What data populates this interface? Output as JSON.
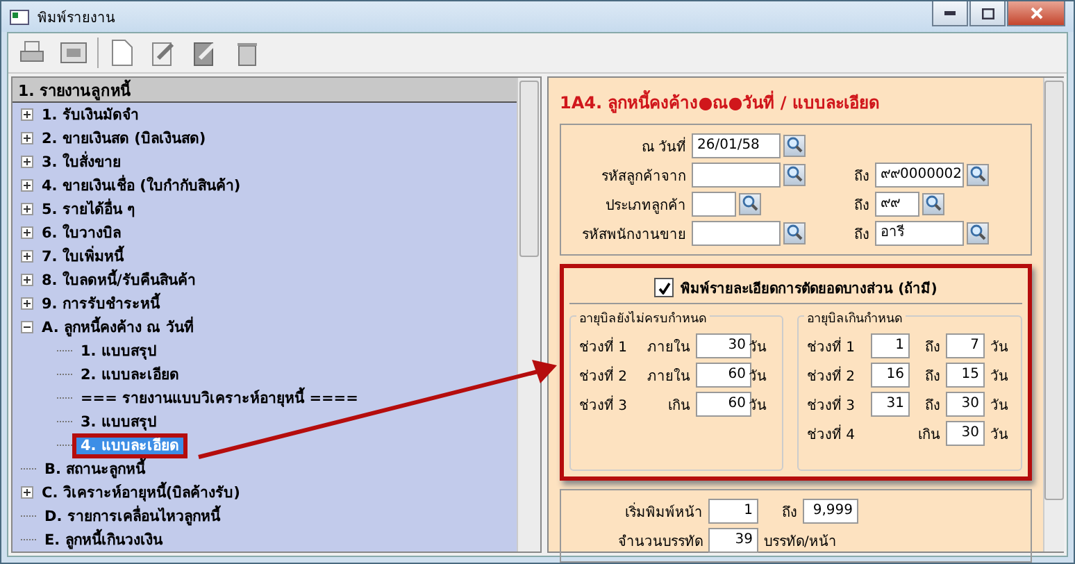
{
  "window": {
    "title": "พิมพ์รายงาน"
  },
  "tree": {
    "header": "1. รายงานลูกหนี้",
    "items": [
      {
        "label": "1. รับเงินมัดจำ",
        "kind": "group",
        "expanded": false,
        "selected": false
      },
      {
        "label": "2. ขายเงินสด (บิลเงินสด)",
        "kind": "group",
        "expanded": false,
        "selected": false
      },
      {
        "label": "3. ใบสั่งขาย",
        "kind": "group",
        "expanded": false,
        "selected": false
      },
      {
        "label": "4. ขายเงินเชื่อ (ใบกำกับสินค้า)",
        "kind": "group",
        "expanded": false,
        "selected": false
      },
      {
        "label": "5. รายได้อื่น ๆ",
        "kind": "group",
        "expanded": false,
        "selected": false
      },
      {
        "label": "6. ใบวางบิล",
        "kind": "group",
        "expanded": false,
        "selected": false
      },
      {
        "label": "7. ใบเพิ่มหนี้",
        "kind": "group",
        "expanded": false,
        "selected": false
      },
      {
        "label": "8. ใบลดหนี้/รับคืนสินค้า",
        "kind": "group",
        "expanded": false,
        "selected": false
      },
      {
        "label": "9. การรับชำระหนี้",
        "kind": "group",
        "expanded": false,
        "selected": false
      },
      {
        "label": "A. ลูกหนี้คงค้าง ณ วันที่",
        "kind": "group",
        "expanded": true,
        "selected": false,
        "children": [
          {
            "label": "1. แบบสรุป",
            "selected": false
          },
          {
            "label": "2. แบบละเอียด",
            "selected": false
          },
          {
            "label": "=== รายงานแบบวิเคราะห์อายุหนี้ ====",
            "selected": false
          },
          {
            "label": "3. แบบสรุป",
            "selected": false
          },
          {
            "label": "4. แบบละเอียด",
            "selected": true
          }
        ]
      },
      {
        "label": "B. สถานะลูกหนี้",
        "kind": "leaf",
        "selected": false
      },
      {
        "label": "C. วิเคราะห์อายุหนี้(บิลค้างรับ)",
        "kind": "group",
        "expanded": false,
        "selected": false
      },
      {
        "label": "D. รายการเคลื่อนไหวลูกหนี้",
        "kind": "leaf",
        "selected": false
      },
      {
        "label": "E. ลูกหนี้เกินวงเงิน",
        "kind": "leaf",
        "selected": false
      }
    ]
  },
  "form": {
    "title": "1A4. ลูกหนี้คงค้าง●ณ●วันที่ / แบบละเอียด",
    "criteria": [
      {
        "kind": "long",
        "label": "ณ วันที่",
        "value": "26/01/58"
      },
      {
        "kind": "long",
        "label": "รหัสลูกค้าจาก",
        "to_label": "ถึง",
        "to_value": "๙๙0000002"
      },
      {
        "kind": "short",
        "label": "ประเภทลูกค้า",
        "to_label": "ถึง",
        "to_value": "๙๙"
      },
      {
        "kind": "long",
        "label": "รหัสพนักงานขาย",
        "to_label": "ถึง",
        "to_value": "อารี"
      }
    ],
    "partial": {
      "label": "พิมพ์รายละเอียดการตัดยอดบางส่วน (ถ้ามี)",
      "checked": true
    },
    "not_due": {
      "title": "อายุบิลยังไม่ครบกำหนด",
      "rows": [
        {
          "label": "ช่วงที่ 1",
          "qualifier": "ภายใน",
          "value": "30",
          "unit": "วัน"
        },
        {
          "label": "ช่วงที่ 2",
          "qualifier": "ภายใน",
          "value": "60",
          "unit": "วัน"
        },
        {
          "label": "ช่วงที่ 3",
          "qualifier": "เกิน",
          "value": "60",
          "unit": "วัน"
        }
      ]
    },
    "overdue": {
      "title": "อายุบิลเกินกำหนด",
      "rows": [
        {
          "kind": "range",
          "label": "ช่วงที่ 1",
          "from": "1",
          "to_label": "ถึง",
          "to": "7",
          "unit": "วัน"
        },
        {
          "kind": "range",
          "label": "ช่วงที่ 2",
          "from": "16",
          "to_label": "ถึง",
          "to": "15",
          "unit": "วัน"
        },
        {
          "kind": "range",
          "label": "ช่วงที่ 3",
          "from": "31",
          "to_label": "ถึง",
          "to": "30",
          "unit": "วัน"
        },
        {
          "kind": "over",
          "label": "ช่วงที่ 4",
          "to_label": "เกิน",
          "to": "30",
          "unit": "วัน"
        }
      ]
    },
    "pages": {
      "label": "เริ่มพิมพ์หน้า",
      "from": "1",
      "to_label": "ถึง",
      "to": "9,999"
    },
    "lines": {
      "label": "จำนวนบรรทัด",
      "value": "39",
      "unit": "บรรทัด/หน้า"
    }
  }
}
